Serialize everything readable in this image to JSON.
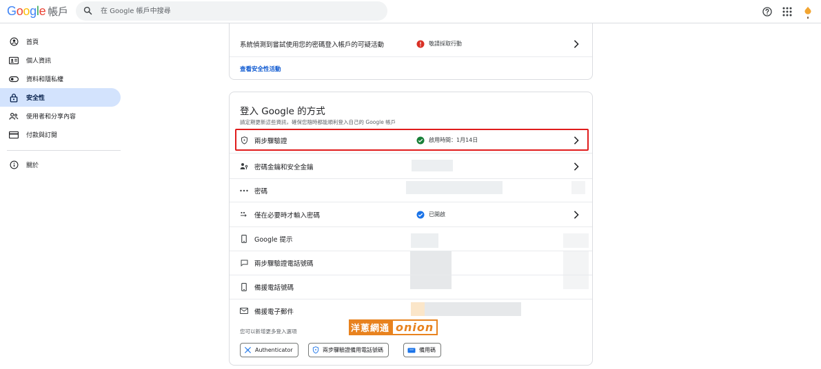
{
  "header": {
    "logo_letters": [
      "G",
      "o",
      "o",
      "g",
      "l",
      "e"
    ],
    "product": "帳戶",
    "search_placeholder": "在 Google 帳戶中搜尋",
    "icons": [
      "help-icon",
      "apps-grid-icon",
      "avatar"
    ]
  },
  "sidebar": {
    "items": [
      {
        "label": "首頁",
        "icon": "home-icon",
        "active": false
      },
      {
        "label": "個人資訊",
        "icon": "id-card-icon",
        "active": false
      },
      {
        "label": "資料和隱私權",
        "icon": "toggle-icon",
        "active": false
      },
      {
        "label": "安全性",
        "icon": "lock-icon",
        "active": true
      },
      {
        "label": "使用者和分享內容",
        "icon": "people-icon",
        "active": false
      },
      {
        "label": "付款與訂閱",
        "icon": "credit-card-icon",
        "active": false
      }
    ],
    "about": {
      "label": "關於",
      "icon": "info-icon"
    }
  },
  "activity_card": {
    "row_title": "系統偵測到嘗試使用您的密碼登入帳戶的可疑活動",
    "status": "敬請採取行動",
    "link": "查看安全性活動"
  },
  "signin_card": {
    "title": "登入 Google 的方式",
    "subtitle": "請定期更新這些資訊，確保您隨時都能順利登入自己的 Google 帳戶",
    "rows": [
      {
        "label": "兩步驟驗證",
        "icon": "shield-icon",
        "status": "啟用時間：1月14日",
        "status_icon": "check-circle-icon",
        "chevron": true
      },
      {
        "label": "密碼金鑰和安全金鑰",
        "icon": "passkey-icon",
        "status": "",
        "chevron": true
      },
      {
        "label": "密碼",
        "icon": "password-dots-icon",
        "status": "",
        "chevron": false
      },
      {
        "label": "僅在必要時才輸入密碼",
        "icon": "skip-password-icon",
        "status": "已開啟",
        "status_icon": "check-circle-blue-icon",
        "chevron": true
      },
      {
        "label": "Google 提示",
        "icon": "phone-icon",
        "status": "",
        "chevron": false
      },
      {
        "label": "兩步驟驗證電話號碼",
        "icon": "message-icon",
        "status": "",
        "chevron": false
      },
      {
        "label": "備援電話號碼",
        "icon": "phone-outline-icon",
        "status": "",
        "chevron": false
      },
      {
        "label": "備援電子郵件",
        "icon": "mail-icon",
        "status": "",
        "chevron": false
      }
    ],
    "more_options_text": "您可以新增更多登入選項",
    "option_buttons": [
      {
        "label": "Authenticator",
        "icon": "authenticator-icon"
      },
      {
        "label": "兩步驟驗證備用電話號碼",
        "icon": "shield-icon"
      },
      {
        "label": "備用碼",
        "icon": "backup-codes-icon"
      }
    ]
  },
  "watermark": {
    "cn": "洋蔥網通",
    "en": "onion"
  },
  "colors": {
    "accent": "#1a73e8",
    "active_nav": "#d3e3fd",
    "alert": "#d93025",
    "success": "#188038",
    "highlight": "#e01b1b"
  }
}
